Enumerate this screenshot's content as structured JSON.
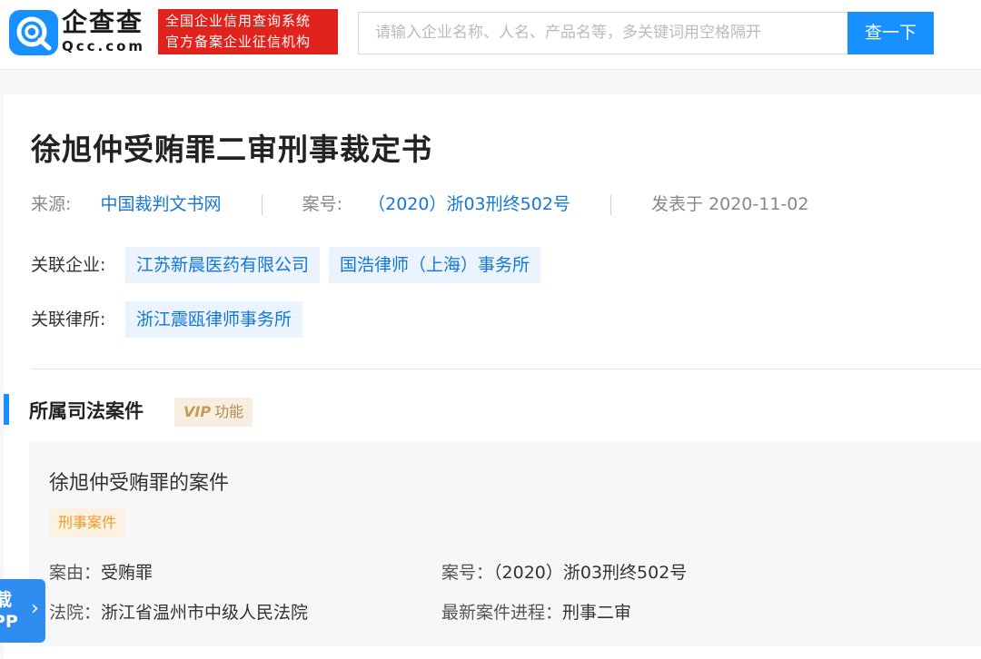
{
  "header": {
    "brand_cn": "企查查",
    "brand_en": "Qcc.com",
    "badge_line1": "全国企业信用查询系统",
    "badge_line2": "官方备案企业征信机构",
    "search_placeholder": "请输入企业名称、人名、产品名等，多关键词用空格隔开",
    "search_button": "查一下"
  },
  "doc": {
    "title": "徐旭仲受贿罪二审刑事裁定书",
    "source_label": "来源:",
    "source_value": "中国裁判文书网",
    "case_no_label": "案号:",
    "case_no_value": "（2020）浙03刑终502号",
    "published": "发表于 2020-11-02",
    "related_company_label": "关联企业:",
    "related_companies": [
      "江苏新晨医药有限公司",
      "国浩律师（上海）事务所"
    ],
    "related_firm_label": "关联律所:",
    "related_firms": [
      "浙江震瓯律师事务所"
    ]
  },
  "section": {
    "title": "所属司法案件",
    "vip_mark": "VIP",
    "vip_text": "功能"
  },
  "case": {
    "title": "徐旭仲受贿罪的案件",
    "tag": "刑事案件",
    "cause_label": "案由：",
    "cause_value": "受贿罪",
    "case_no_label": "案号：",
    "case_no_value": "（2020）浙03刑终502号",
    "court_label": "法院：",
    "court_value": "浙江省温州市中级人民法院",
    "progress_label": "最新案件进程：",
    "progress_value": "刑事二审"
  },
  "float_tab": {
    "line1": "载",
    "line2": "PP"
  },
  "colors": {
    "accent": "#1890ff",
    "brand_red": "#e0231c",
    "link_blue": "#1477d8"
  }
}
